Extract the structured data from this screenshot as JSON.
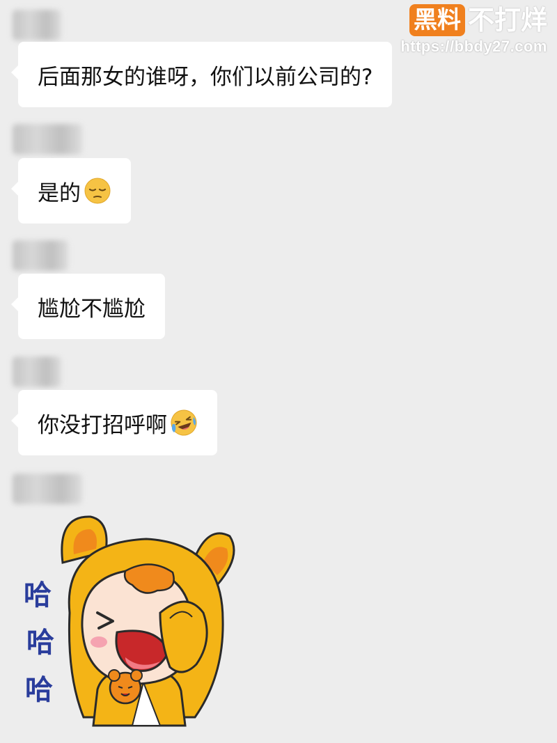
{
  "watermark": {
    "badge": "黑料",
    "slogan": "不打烊",
    "url": "https://bbdy27.com"
  },
  "messages": [
    {
      "text": "后面那女的谁呀，你们以前公司的?",
      "emoji": ""
    },
    {
      "text": "是的",
      "emoji": "sleepy-face-emoji"
    },
    {
      "text": "尴尬不尴尬",
      "emoji": ""
    },
    {
      "text": "你没打招呼啊",
      "emoji": "laughing-crying-face-emoji"
    }
  ],
  "sticker": {
    "laugh": [
      "哈",
      "哈",
      "哈"
    ],
    "icon": "laughing-bear-costume-kid-sticker"
  },
  "colors": {
    "background": "#ededed",
    "bubble": "#ffffff",
    "watermark_badge": "#f0801e",
    "sticker_yellow": "#f4b416",
    "sticker_text": "#2a3d9c"
  }
}
